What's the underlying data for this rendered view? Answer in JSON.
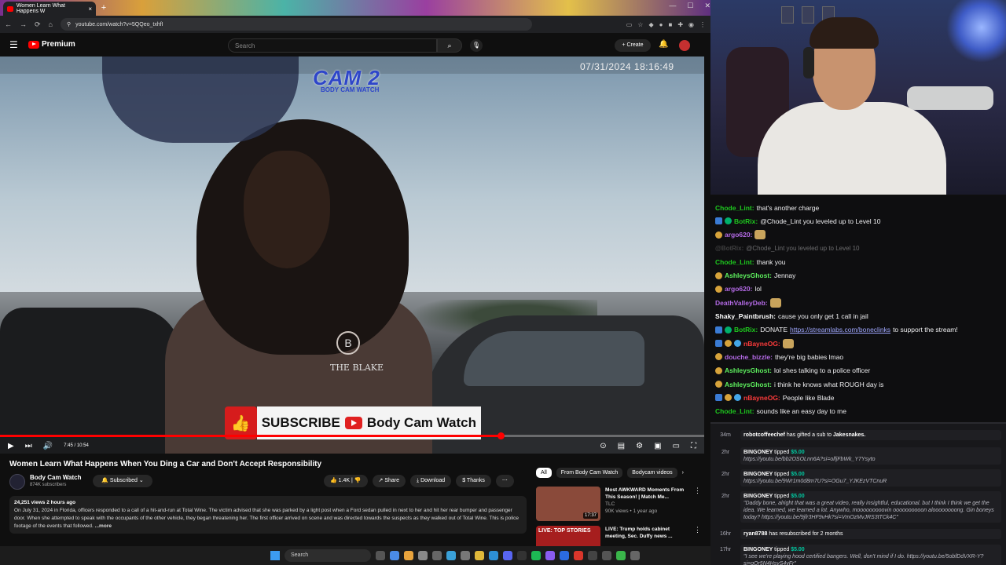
{
  "browser": {
    "tab_title": "Women Learn What Happens W",
    "url": "youtube.com/watch?v=5QQeo_txhfI",
    "new_tab_symbol": "+",
    "tab_close_symbol": "×"
  },
  "youtube_header": {
    "menu_icon": "hamburger-icon",
    "logo_text": "Premium",
    "search_placeholder": "Search",
    "create_label": "+ Create"
  },
  "video": {
    "cam_label": "CAM 2",
    "cam_sublabel": "BODY CAM WATCH",
    "timestamp": "07/31/2024 18:16:49",
    "shirt_logo_letter": "B",
    "shirt_logo_text": "THE BLAKE",
    "subscribe_banner_text": "SUBSCRIBE",
    "subscribe_banner_channel": "Body Cam Watch",
    "time_display": "7:45 / 10:54",
    "progress_fraction": 0.711
  },
  "below_video": {
    "title": "Women Learn What Happens When You Ding a Car and Don't Accept Responsibility",
    "channel_name": "Body Cam Watch",
    "channel_subs": "874K subscribers",
    "subscribed_label": "Subscribed",
    "like_count": "1.4K",
    "share_label": "Share",
    "download_label": "Download",
    "thanks_label": "Thanks",
    "desc_meta": "24,251 views  2 hours ago",
    "desc_text": "On July 31, 2024 in Florida, officers responded to a call of a hit-and-run at Total Wine. The victim advised that she was parked by a light post when a Ford sedan pulled in next to her and hit her rear bumper and passenger door. When she attempted to speak with the occupants of the other vehicle, they began threatening her.  The first officer arrived on scene and was directed towards the suspects as they walked out of Total Wine. This is police footage of the events that followed.",
    "desc_more": "...more"
  },
  "recommendations": {
    "chips": [
      "All",
      "From Body Cam Watch",
      "Bodycam videos"
    ],
    "items": [
      {
        "title": "Most AWKWARD Moments From This Season! | Match Me...",
        "channel": "TLC",
        "meta": "90K views • 1 year ago",
        "duration": "17:37",
        "thumb_color": "#8a4a3a"
      },
      {
        "title": "LIVE: Trump holds cabinet meeting, Sec. Duffy news ...",
        "channel": "",
        "meta": "",
        "duration": "",
        "thumb_color": "#a61e1e",
        "badge": "LIVE: TOP STORIES"
      }
    ]
  },
  "chat": {
    "messages": [
      {
        "user": "Chode_Lint",
        "color": "#1ec91e",
        "text": "that's another charge",
        "badges": []
      },
      {
        "user": "BotRix",
        "color": "#1ec91e",
        "text": "@Chode_Lint you leveled up to Level 10",
        "badges": [
          "b-sword",
          "b-check"
        ]
      },
      {
        "user": "argo620",
        "color": "#b46ae6",
        "text": "",
        "badges": [
          "b-coin"
        ],
        "emote": true
      },
      {
        "user": "@BotRix",
        "color": "#888",
        "text": "@Chode_Lint you leveled up to Level 10",
        "badges": [],
        "faded": true
      },
      {
        "user": "Chode_Lint",
        "color": "#1ec91e",
        "text": "thank you",
        "badges": []
      },
      {
        "user": "AshleysGhost",
        "color": "#5ef05e",
        "text": "Jennay",
        "badges": [
          "b-coin"
        ]
      },
      {
        "user": "argo620",
        "color": "#b46ae6",
        "text": "lol",
        "badges": [
          "b-coin"
        ]
      },
      {
        "user": "DeathValleyDeb",
        "color": "#b46ae6",
        "text": "",
        "badges": [],
        "emote": true
      },
      {
        "user": "Shaky_Paintbrush",
        "color": "#ffffff",
        "text": "cause you only get 1 call in jail",
        "badges": []
      },
      {
        "user": "BotRix",
        "color": "#1ec91e",
        "text": "DONATE ",
        "link": "https://streamlabs.com/boneclinks",
        "after": " to support the stream!",
        "badges": [
          "b-sword",
          "b-check"
        ]
      },
      {
        "user": "nBayneOG",
        "color": "#ff3b3b",
        "text": "",
        "badges": [
          "b-sword",
          "b-coin",
          "b-gem"
        ],
        "emote": true
      },
      {
        "user": "douche_bizzle",
        "color": "#b46ae6",
        "text": "they're big babies lmao",
        "badges": [
          "b-coin"
        ]
      },
      {
        "user": "AshleysGhost",
        "color": "#5ef05e",
        "text": "lol shes talking to a police officer",
        "badges": [
          "b-coin"
        ]
      },
      {
        "user": "AshleysGhost",
        "color": "#5ef05e",
        "text": "i think he knows what ROUGH day is",
        "badges": [
          "b-coin"
        ]
      },
      {
        "user": "nBayneOG",
        "color": "#ff3b3b",
        "text": "People like Blade",
        "badges": [
          "b-sword",
          "b-coin",
          "b-gem"
        ]
      },
      {
        "user": "Chode_Lint",
        "color": "#1ec91e",
        "text": "sounds like an easy day to me",
        "badges": []
      }
    ]
  },
  "events": {
    "items": [
      {
        "age": "34m",
        "who": "robotcoffeechef",
        "action": "has gifted a sub to",
        "target": "Jakesnakes."
      },
      {
        "age": "2hr",
        "who": "BINGONEY",
        "action": "tipped",
        "amount": "$5.00",
        "msg": "https://youtu.be/bb2OSOLnn6A?si=olfjFbWk_Y7Ysyto"
      },
      {
        "age": "2hr",
        "who": "BINGONEY",
        "action": "tipped",
        "amount": "$5.00",
        "msg": "https://youtu.be/9Wr1m0d8m7U?si=OGu7_YJKEzVTCnuR"
      },
      {
        "age": "2hr",
        "who": "BINGONEY",
        "action": "tipped",
        "amount": "$5.00",
        "msg": "\"Daddy bone, alright that was a great video, really insightful, educational. but I think I think we get the idea. We learned, we learned a lot. Anywho, mooooooooovin oooooooooon aloooooooong. Gin boneys today? https://youtu.be/9jfr3HF9vHk?si=VmOzMvJRS3tTCk4C\""
      },
      {
        "age": "16hr",
        "who": "ryan8788",
        "action": "has resubscribed for 2 months",
        "amount": "",
        "msg": ""
      },
      {
        "age": "17hr",
        "who": "BINGONEY",
        "action": "tipped",
        "amount": "$5.00",
        "msg": "\"I see we're playing hood certified bangers. Well, don't mind if I do. https://youtu.be/5obfDdVXR-Y?si=gOr5N4HsvS4vFr\""
      }
    ]
  },
  "taskbar": {
    "search_label": "Search"
  },
  "colors": {
    "yt_red": "#ff0000",
    "chat_bg": "#0e0e10"
  }
}
